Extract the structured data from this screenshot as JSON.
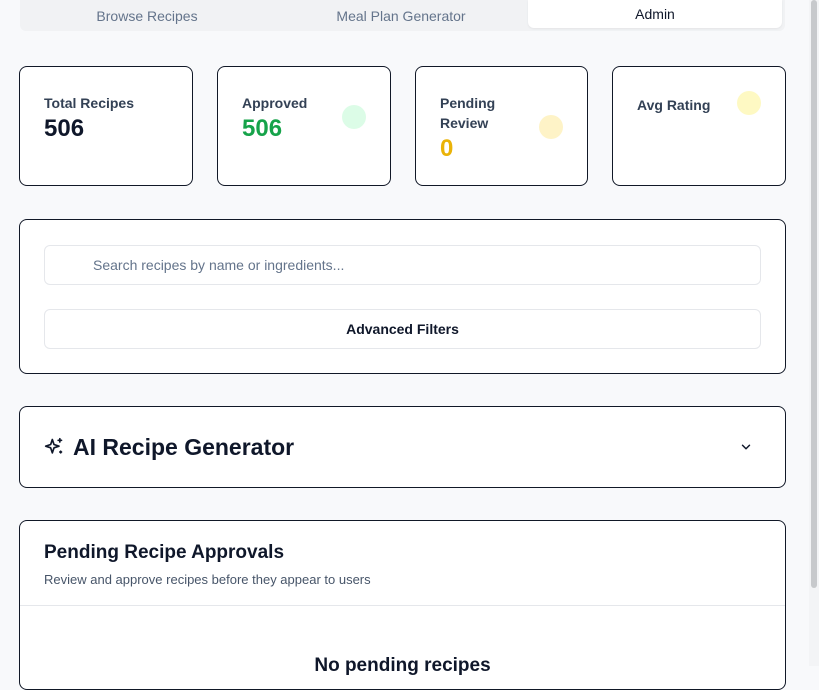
{
  "tabs": [
    {
      "label": "Browse Recipes",
      "active": false
    },
    {
      "label": "Meal Plan Generator",
      "active": false
    },
    {
      "label": "Admin",
      "active": true
    }
  ],
  "stats": {
    "total": {
      "label": "Total Recipes",
      "value": "506"
    },
    "approved": {
      "label": "Approved",
      "value": "506",
      "color": "#16a34a",
      "dot_color": "#dcfce7"
    },
    "pending": {
      "label": "Pending Review",
      "value": "0",
      "color": "#eab308",
      "dot_color": "#fef3c7"
    },
    "avg_rating": {
      "label": "Avg Rating",
      "value": "",
      "dot_color": "#fef9c3"
    }
  },
  "search": {
    "placeholder": "Search recipes by name or ingredients...",
    "value": "",
    "advanced_filters_label": "Advanced Filters"
  },
  "ai_generator": {
    "title": "AI Recipe Generator",
    "icon": "sparkles-icon",
    "expand_icon": "chevron-down-icon"
  },
  "pending_approvals": {
    "title": "Pending Recipe Approvals",
    "subtitle": "Review and approve recipes before they appear to users",
    "empty_message": "No pending recipes"
  }
}
